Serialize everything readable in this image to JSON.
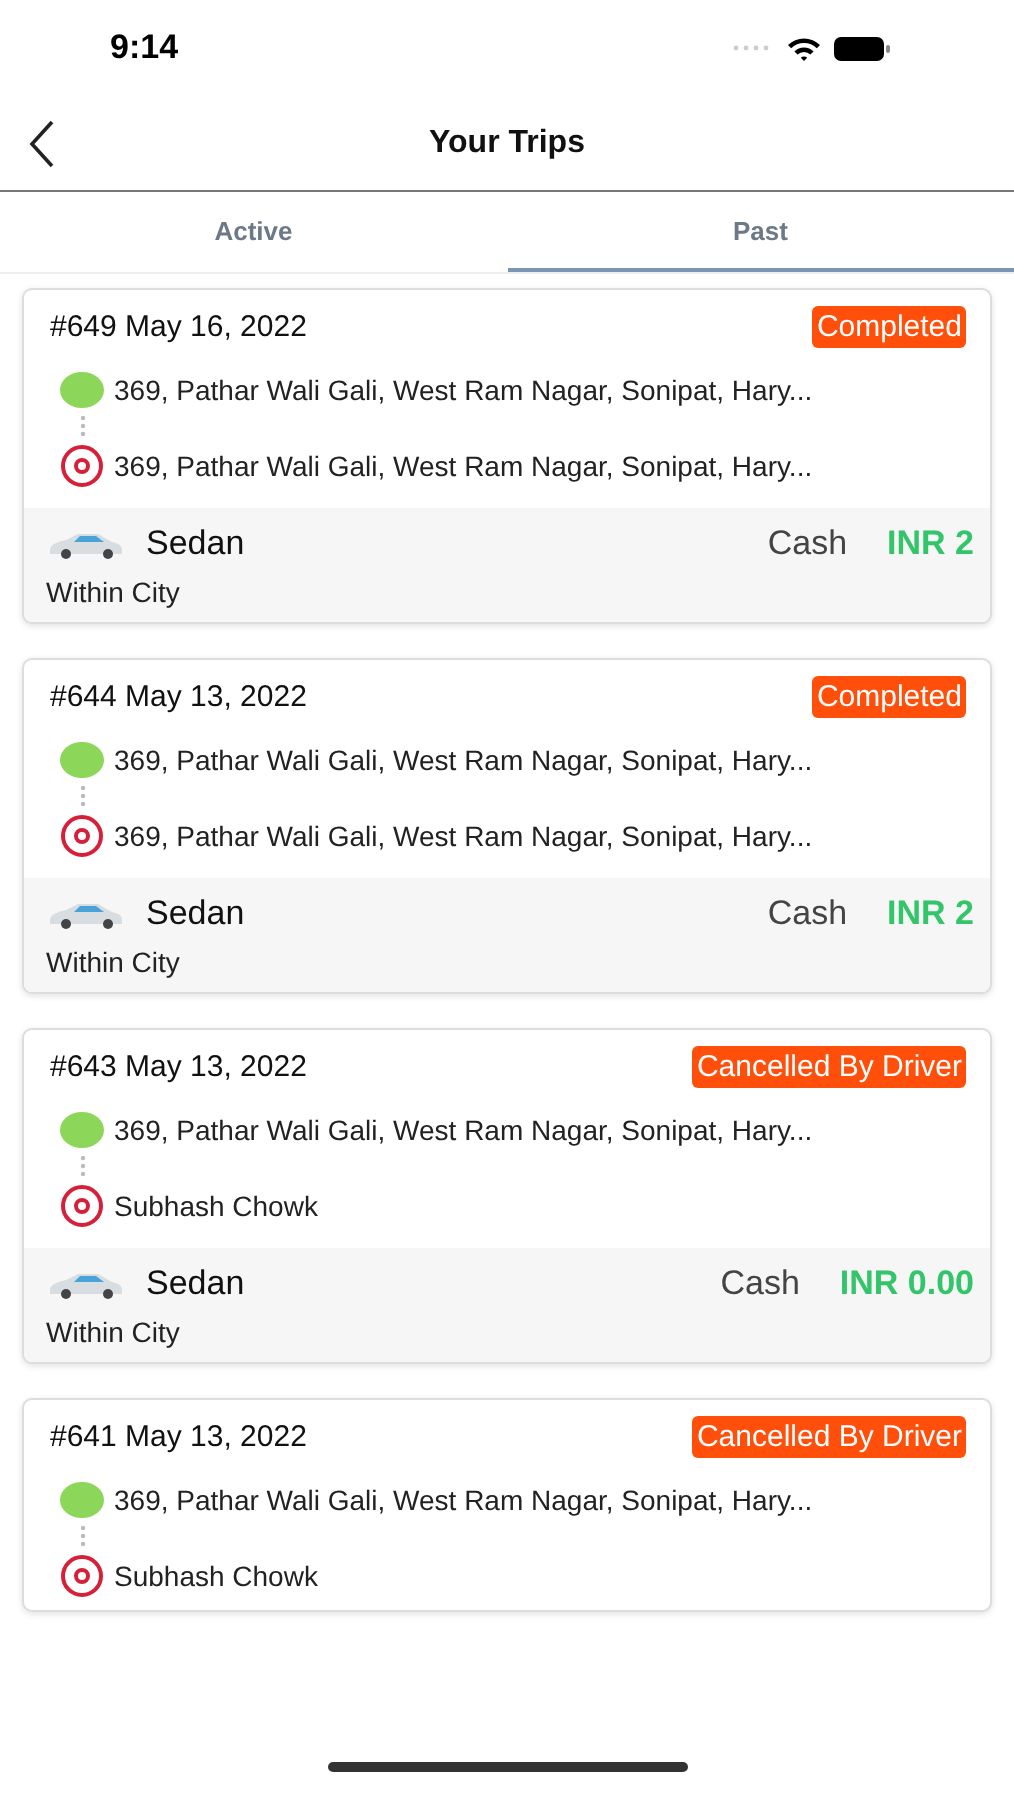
{
  "status_bar": {
    "time": "9:14"
  },
  "header": {
    "title": "Your Trips"
  },
  "tabs": [
    {
      "label": "Active",
      "selected": false
    },
    {
      "label": "Past",
      "selected": true
    }
  ],
  "trips": [
    {
      "id": "#649 May 16, 2022",
      "status": "Completed",
      "pickup": "369, Pathar Wali Gali, West Ram Nagar, Sonipat, Hary...",
      "drop": "369, Pathar Wali Gali, West Ram Nagar, Sonipat, Hary...",
      "vehicle": "Sedan",
      "payment": "Cash",
      "fare": "INR 2",
      "area": "Within City"
    },
    {
      "id": "#644 May 13, 2022",
      "status": "Completed",
      "pickup": "369, Pathar Wali Gali, West Ram Nagar, Sonipat, Hary...",
      "drop": "369, Pathar Wali Gali, West Ram Nagar, Sonipat, Hary...",
      "vehicle": "Sedan",
      "payment": "Cash",
      "fare": "INR 2",
      "area": "Within City"
    },
    {
      "id": "#643 May 13, 2022",
      "status": "Cancelled By Driver",
      "pickup": "369, Pathar Wali Gali, West Ram Nagar, Sonipat, Hary...",
      "drop": "Subhash Chowk",
      "vehicle": "Sedan",
      "payment": "Cash",
      "fare": "INR 0.00",
      "area": "Within City"
    },
    {
      "id": "#641 May 13, 2022",
      "status": "Cancelled By Driver",
      "pickup": "369, Pathar Wali Gali, West Ram Nagar, Sonipat, Hary...",
      "drop": "Subhash Chowk"
    }
  ]
}
